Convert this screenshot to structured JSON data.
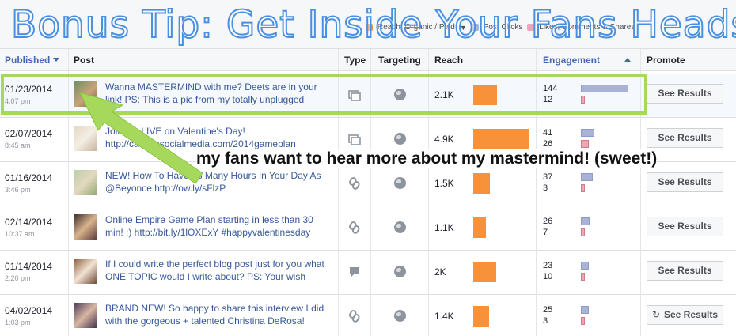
{
  "overlay": {
    "headline": "Bonus Tip: Get Inside Your Fans Heads",
    "annotation": "my fans want to hear more about my mastermind! (sweet!)"
  },
  "legend": {
    "items": [
      "Reach: Organic / Paid",
      "Post Clicks",
      "Likes, Comments & Shares"
    ],
    "colors": {
      "organic": "#f7923a",
      "clicks": "#a8b3d6",
      "likes": "#f0a5b4"
    }
  },
  "table": {
    "headers": {
      "published": "Published",
      "post": "Post",
      "type": "Type",
      "targeting": "Targeting",
      "reach": "Reach",
      "engagement": "Engagement",
      "promote": "Promote"
    },
    "rows": [
      {
        "date": "01/23/2014",
        "time": "4:07 pm",
        "post": "Wanna MASTERMIND with me? Deets are in your link! PS: This is a pic from my totally unplugged",
        "type": "album-icon",
        "reach": "2.1K",
        "reach_value": 2.1,
        "clicks": "144",
        "likes": "12",
        "button": "See Results"
      },
      {
        "date": "02/07/2014",
        "time": "8:45 am",
        "post": "Join me LIVE on Valentine's Day! http://catcomsocialmedia.com/2014gameplan",
        "type": "album-icon",
        "reach": "4.9K",
        "reach_value": 4.9,
        "clicks": "41",
        "likes": "26",
        "button": "See Results"
      },
      {
        "date": "01/16/2014",
        "time": "3:46 pm",
        "post": "NEW! How To Have As Many Hours In Your Day As @Beyonce http://ow.ly/sFlzP",
        "type": "link-icon",
        "reach": "1.5K",
        "reach_value": 1.5,
        "clicks": "37",
        "likes": "3",
        "button": "See Results"
      },
      {
        "date": "02/14/2014",
        "time": "10:37 am",
        "post": "Online Empire Game Plan starting in less than 30 min! :) http://bit.ly/1lOXExY #happyvalentinesday",
        "type": "link-icon",
        "reach": "1.1K",
        "reach_value": 1.1,
        "clicks": "26",
        "likes": "7",
        "button": "See Results"
      },
      {
        "date": "01/14/2014",
        "time": "2:20 pm",
        "post": "If I could write the perfect blog post just for you what ONE TOPIC would I write about? PS: Your wish",
        "type": "status-icon",
        "reach": "2K",
        "reach_value": 2.0,
        "clicks": "23",
        "likes": "10",
        "button": "See Results"
      },
      {
        "date": "04/02/2014",
        "time": "1:03 pm",
        "post": "BRAND NEW! So happy to share this interview I did with the gorgeous + talented Christina DeRosa!",
        "type": "link-icon",
        "reach": "1.4K",
        "reach_value": 1.4,
        "clicks": "25",
        "likes": "3",
        "button": "See Results"
      }
    ]
  }
}
